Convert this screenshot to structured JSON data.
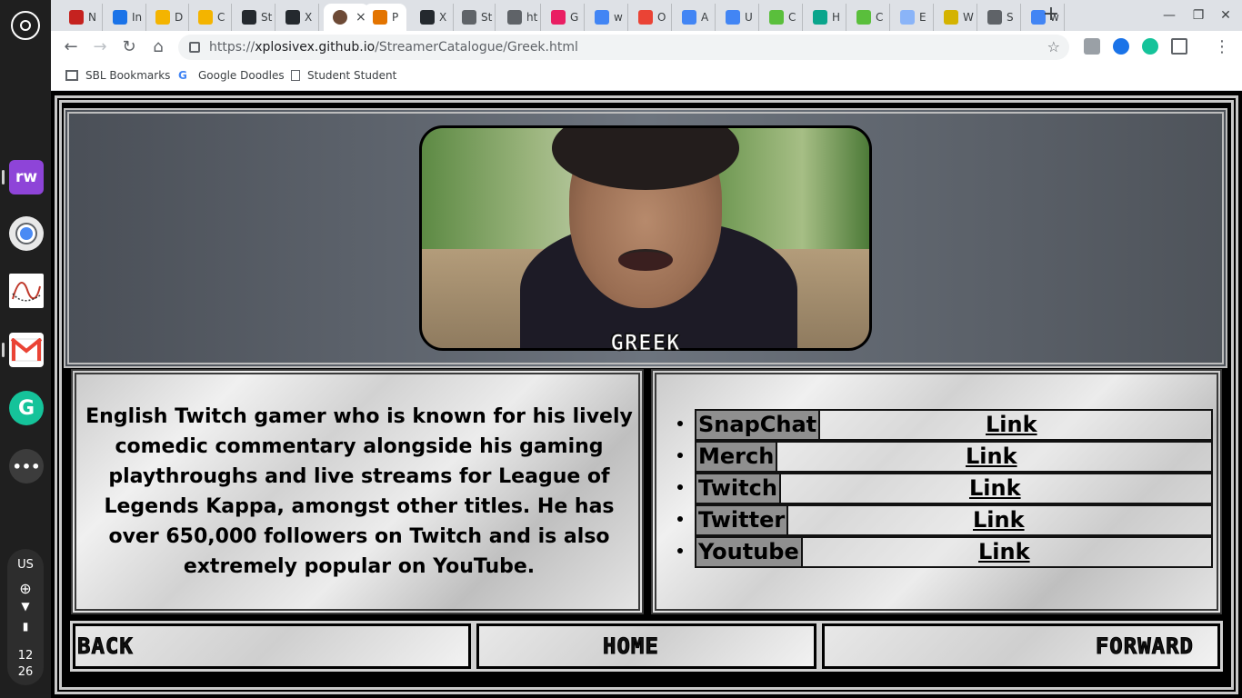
{
  "browser": {
    "tabs": [
      {
        "label": "N",
        "color": "#c5221f"
      },
      {
        "label": "In",
        "color": "#1a73e8"
      },
      {
        "label": "D",
        "color": "#f4b400"
      },
      {
        "label": "C",
        "color": "#f4b400"
      },
      {
        "label": "St",
        "color": "#24292e"
      },
      {
        "label": "X",
        "color": "#24292e"
      },
      {
        "label": "P",
        "color": "#e37400"
      },
      {
        "label": "X",
        "color": "#24292e"
      },
      {
        "label": "St",
        "color": "#5f6368"
      },
      {
        "label": "ht",
        "color": "#5f6368"
      },
      {
        "label": "G",
        "color": "#e91e63"
      },
      {
        "label": "w",
        "color": "#4285f4"
      },
      {
        "label": "O",
        "color": "#ea4335"
      },
      {
        "label": "A",
        "color": "#4285f4"
      },
      {
        "label": "U",
        "color": "#4285f4"
      },
      {
        "label": "C",
        "color": "#5abf3c"
      },
      {
        "label": "H",
        "color": "#0aa58c"
      },
      {
        "label": "C",
        "color": "#5abf3c"
      },
      {
        "label": "E",
        "color": "#8ab4f8"
      },
      {
        "label": "W",
        "color": "#d4b300"
      },
      {
        "label": "S",
        "color": "#5f6368"
      },
      {
        "label": "w",
        "color": "#4285f4"
      }
    ],
    "active_tab_close": "×",
    "new_tab": "+",
    "url_host": "xplosivex.github.io",
    "url_scheme": "https://",
    "url_path": "/StreamerCatalogue/Greek.html",
    "bookmarks": [
      "SBL Bookmarks",
      "Google Doodles",
      "Student Student"
    ]
  },
  "shelf": {
    "app_rw": "rw",
    "tray_region": "US",
    "tray_time_h": "12",
    "tray_time_m": "26"
  },
  "streamer": {
    "name": "GREEK",
    "bio": "English Twitch gamer who is known for his lively comedic commentary alongside his gaming playthroughs and live streams for League of Legends Kappa, amongst other titles. He has over 650,000 followers on Twitch and is also extremely popular on YouTube.",
    "links": [
      {
        "label": "SnapChat",
        "link_text": "Link"
      },
      {
        "label": "Merch",
        "link_text": "Link"
      },
      {
        "label": "Twitch",
        "link_text": "Link"
      },
      {
        "label": "Twitter",
        "link_text": "Link"
      },
      {
        "label": "Youtube",
        "link_text": "Link"
      }
    ]
  },
  "nav": {
    "back": "BACK",
    "home": "HOME",
    "forward": "FORWARD"
  }
}
